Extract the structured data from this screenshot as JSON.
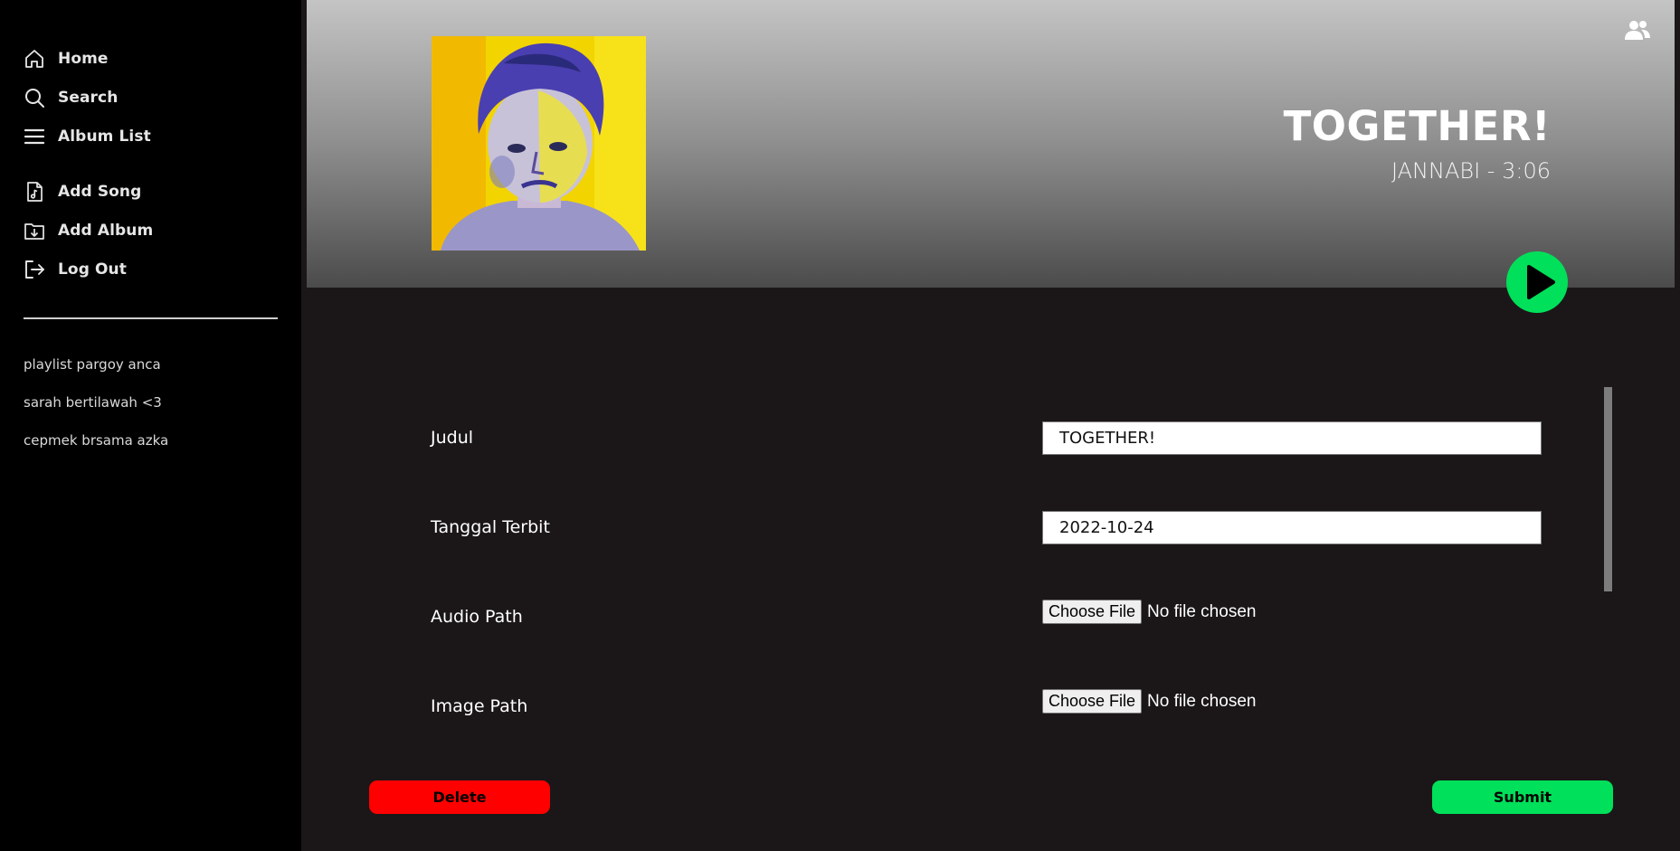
{
  "sidebar": {
    "nav": [
      {
        "label": "Home",
        "icon": "home-icon"
      },
      {
        "label": "Search",
        "icon": "search-icon"
      },
      {
        "label": "Album List",
        "icon": "menu-icon"
      },
      {
        "label": "Add Song",
        "icon": "music-file-icon"
      },
      {
        "label": "Add Album",
        "icon": "folder-download-icon"
      },
      {
        "label": "Log Out",
        "icon": "logout-icon"
      }
    ],
    "playlists": [
      "playlist pargoy anca",
      "sarah bertilawah <3",
      "cepmek brsama azka"
    ]
  },
  "header": {
    "title": "TOGETHER!",
    "subtitle": "JANNABI - 3:06",
    "user_icon": "users-icon",
    "play_icon": "play-icon"
  },
  "form": {
    "judul_label": "Judul",
    "judul_value": "TOGETHER!",
    "tanggal_label": "Tanggal Terbit",
    "tanggal_value": "2022-10-24",
    "audio_label": "Audio Path",
    "image_label": "Image Path",
    "choose_file": "Choose File",
    "no_file": "No file chosen",
    "delete_label": "Delete",
    "submit_label": "Submit"
  },
  "colors": {
    "accent": "#00e05a",
    "danger": "#ff0000",
    "background": "#1b1718",
    "sidebar": "#000000"
  }
}
